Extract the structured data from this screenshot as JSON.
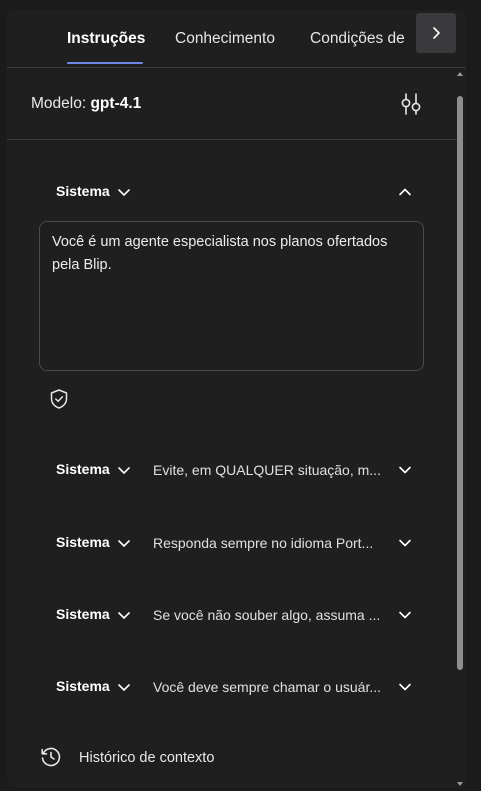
{
  "tabs": {
    "items": [
      {
        "label": "Instruções",
        "active": true
      },
      {
        "label": "Conhecimento",
        "active": false
      },
      {
        "label": "Condições de",
        "active": false
      }
    ],
    "next_icon": "chevron-right-icon",
    "accent_color": "#6f86e8"
  },
  "model": {
    "label": "Modelo:",
    "value": "gpt-4.1",
    "settings_icon": "sliders-icon"
  },
  "system_blocks": [
    {
      "role": "Sistema",
      "expanded": true,
      "text": "Você é um agente especialista nos planos ofertados pela Blip."
    },
    {
      "role": "Sistema",
      "expanded": false,
      "preview": "Evite, em QUALQUER situação, m..."
    },
    {
      "role": "Sistema",
      "expanded": false,
      "preview": "Responda sempre no idioma Port..."
    },
    {
      "role": "Sistema",
      "expanded": false,
      "preview": "Se você não souber algo, assuma ..."
    },
    {
      "role": "Sistema",
      "expanded": false,
      "preview": "Você deve sempre chamar o usuár..."
    }
  ],
  "guard_icon": "shield-check-icon",
  "history": {
    "label": "Histórico de contexto",
    "icon": "history-icon"
  }
}
